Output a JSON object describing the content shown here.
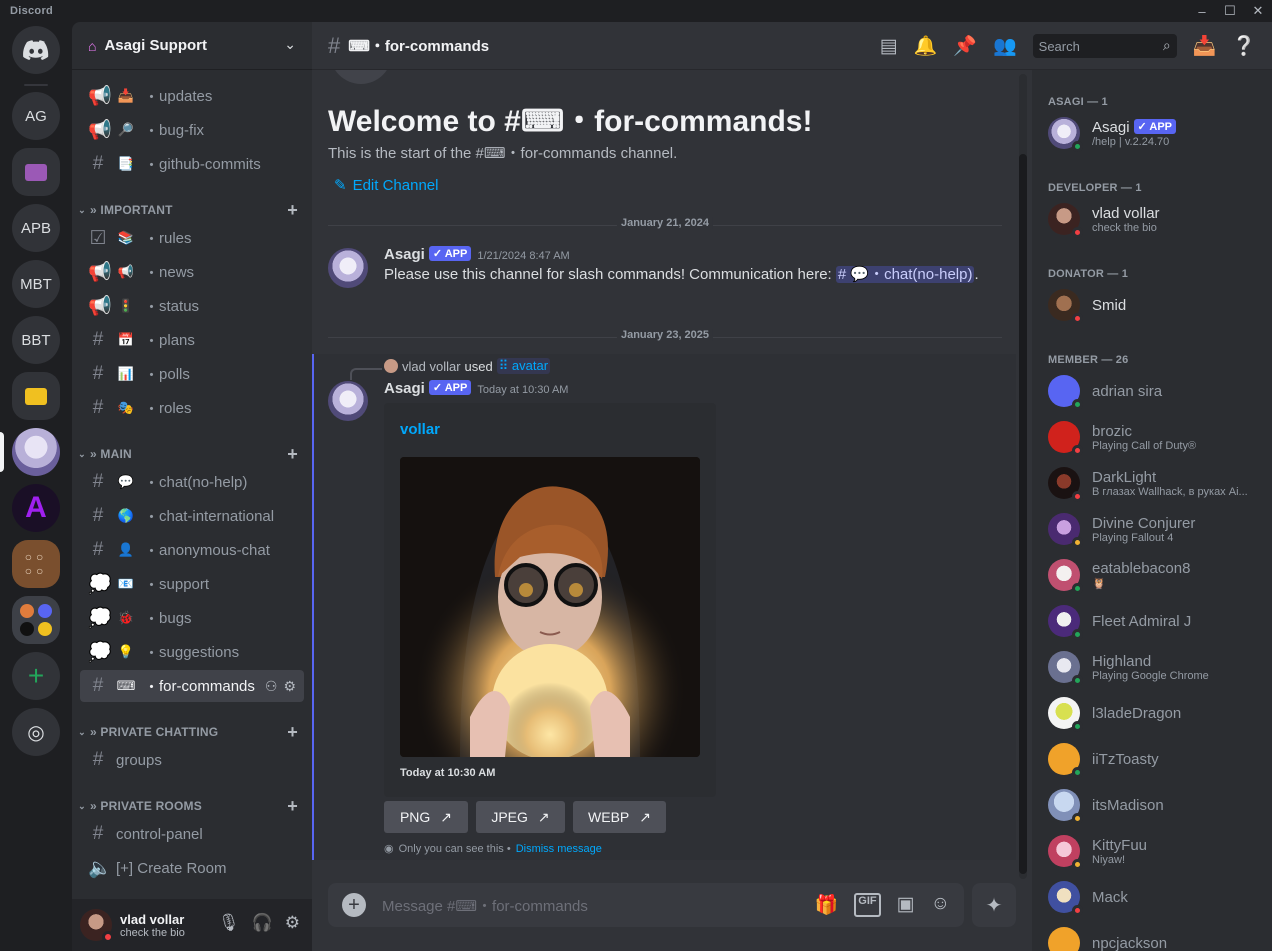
{
  "app": {
    "title": "Discord"
  },
  "servers": [
    "AG",
    "APB",
    "MBT",
    "BBT"
  ],
  "guild": {
    "name": "Asagi Support"
  },
  "channels": [
    {
      "name": "updates",
      "emoji": "📥"
    },
    {
      "name": "bug-fix",
      "emoji": "🔎"
    },
    {
      "name": "github-commits",
      "emoji": "📑"
    }
  ],
  "categories": {
    "important": "» IMPORTANT",
    "main": "» MAIN",
    "private_chatting": "» PRIVATE CHATTING",
    "private_rooms": "» PRIVATE ROOMS"
  },
  "important_channels": [
    {
      "name": "rules",
      "emoji": "📚"
    },
    {
      "name": "news",
      "emoji": "📢"
    },
    {
      "name": "status",
      "emoji": "🚦"
    },
    {
      "name": "plans",
      "emoji": "📅"
    },
    {
      "name": "polls",
      "emoji": "📊"
    },
    {
      "name": "roles",
      "emoji": "🎭"
    }
  ],
  "main_channels": [
    {
      "name": "chat(no-help)",
      "emoji": "💬"
    },
    {
      "name": "chat-international",
      "emoji": "🌎"
    },
    {
      "name": "anonymous-chat",
      "emoji": "👤"
    },
    {
      "name": "support",
      "emoji": "📧"
    },
    {
      "name": "bugs",
      "emoji": "🐞"
    },
    {
      "name": "suggestions",
      "emoji": "💡"
    },
    {
      "name": "for-commands",
      "emoji": "⌨"
    }
  ],
  "private_chatting_channels": [
    {
      "name": "groups"
    }
  ],
  "private_rooms_channels": [
    {
      "name": "control-panel"
    },
    {
      "name": "[+] Create Room"
    }
  ],
  "channel_prefix": "・",
  "user": {
    "name": "vlad vollar",
    "status": "check the bio"
  },
  "header": {
    "channel": "⌨・for-commands",
    "search_placeholder": "Search"
  },
  "welcome": {
    "heading": "Welcome to #⌨・for-commands!",
    "subtitle": "This is the start of the #⌨・for-commands channel.",
    "edit": "Edit Channel"
  },
  "dates": {
    "first": "January 21, 2024",
    "second": "January 23, 2025"
  },
  "messages": [
    {
      "author": "Asagi",
      "badge": "✓ APP",
      "timestamp": "1/21/2024 8:47 AM",
      "text": "Please use this channel for slash commands! Communication here: ",
      "mention": "# 💬・chat(no-help)",
      "text_end": "."
    },
    {
      "reply_user": "vlad vollar",
      "reply_used": "used",
      "reply_command": "avatar",
      "author": "Asagi",
      "badge": "✓ APP",
      "timestamp": "Today at 10:30 AM",
      "embed_title": "vollar",
      "embed_footer": "Today at 10:30 AM",
      "buttons": [
        "PNG",
        "JPEG",
        "WEBP"
      ],
      "ephemeral": "Only you can see this • ",
      "dismiss": "Dismiss message"
    }
  ],
  "composer": {
    "placeholder": "Message #⌨・for-commands"
  },
  "member_groups": {
    "asagi": "ASAGI — 1",
    "developer": "DEVELOPER — 1",
    "donator": "DONATOR — 1",
    "member": "MEMBER — 26"
  },
  "members": [
    {
      "name": "Asagi",
      "badge": "✓ APP",
      "sub": "/help | v.2.24.70"
    },
    {
      "name": "vlad vollar",
      "sub": "check the bio"
    },
    {
      "name": "Smid",
      "sub": ""
    },
    {
      "name": "adrian sira",
      "sub": ""
    },
    {
      "name": "brozic",
      "sub": "Playing Call of Duty®"
    },
    {
      "name": "DarkLight",
      "sub": "В глазах Wallhack, в руках Ai..."
    },
    {
      "name": "Divine Conjurer",
      "sub": "Playing Fallout 4"
    },
    {
      "name": "eatablebacon8",
      "sub": "🦉"
    },
    {
      "name": "Fleet Admiral J",
      "sub": ""
    },
    {
      "name": "Highland",
      "sub": "Playing Google Chrome"
    },
    {
      "name": "l3ladeDragon",
      "sub": ""
    },
    {
      "name": "iiTzToasty",
      "sub": ""
    },
    {
      "name": "itsMadison",
      "sub": ""
    },
    {
      "name": "KittyFuu",
      "sub": "Niyaw!"
    },
    {
      "name": "Mack",
      "sub": ""
    },
    {
      "name": "npcjackson",
      "sub": ""
    }
  ],
  "colors": {
    "accent": "#5865f2",
    "link": "#00a8fc",
    "online": "#23a55a",
    "dnd": "#f23f43",
    "idle": "#f0b232"
  }
}
